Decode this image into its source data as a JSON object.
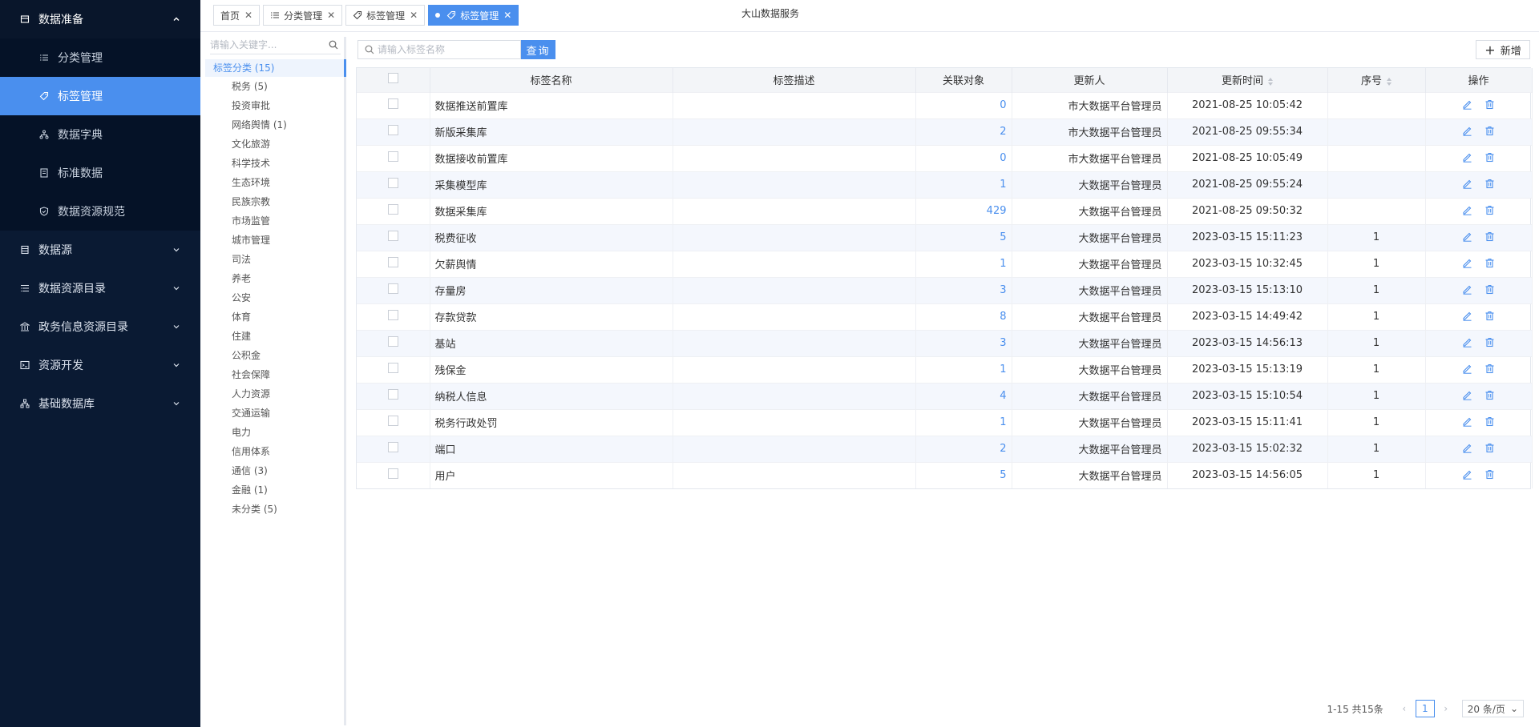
{
  "app_title": "大山数据服务",
  "sidebar": {
    "groups": [
      {
        "label": "数据准备",
        "open": true,
        "icon": "box-icon",
        "items": [
          {
            "label": "分类管理",
            "icon": "list-icon"
          },
          {
            "label": "标签管理",
            "icon": "tag-icon",
            "active": true
          },
          {
            "label": "数据字典",
            "icon": "tree-icon"
          },
          {
            "label": "标准数据",
            "icon": "doc-icon"
          },
          {
            "label": "数据资源规范",
            "icon": "shield-icon"
          }
        ]
      },
      {
        "label": "数据源",
        "icon": "database-icon"
      },
      {
        "label": "数据资源目录",
        "icon": "catalog-icon"
      },
      {
        "label": "政务信息资源目录",
        "icon": "building-icon"
      },
      {
        "label": "资源开发",
        "icon": "terminal-icon"
      },
      {
        "label": "基础数据库",
        "icon": "network-icon"
      }
    ]
  },
  "tabs": [
    {
      "label": "首页",
      "icon": null
    },
    {
      "label": "分类管理",
      "icon": "list-icon"
    },
    {
      "label": "标签管理",
      "icon": "tag-icon"
    },
    {
      "label": "标签管理",
      "icon": "tag-icon",
      "active": true
    }
  ],
  "tree": {
    "search_placeholder": "请输入关键字...",
    "root": "标签分类 (15)",
    "nodes": [
      "税务 (5)",
      "投资审批",
      "网络舆情 (1)",
      "文化旅游",
      "科学技术",
      "生态环境",
      "民族宗教",
      "市场监管",
      "城市管理",
      "司法",
      "养老",
      "公安",
      "体育",
      "住建",
      "公积金",
      "社会保障",
      "人力资源",
      "交通运输",
      "电力",
      "信用体系",
      "通信 (3)",
      "金融 (1)",
      "未分类 (5)"
    ]
  },
  "toolbar": {
    "search_placeholder": "请输入标签名称",
    "query_label": "查询",
    "add_label": "新增"
  },
  "table": {
    "columns": [
      "标签名称",
      "标签描述",
      "关联对象",
      "更新人",
      "更新时间",
      "序号",
      "操作"
    ],
    "rows": [
      {
        "name": "数据推送前置库",
        "desc": "",
        "count": "0",
        "updater": "市大数据平台管理员",
        "time": "2021-08-25 10:05:42",
        "seq": ""
      },
      {
        "name": "新版采集库",
        "desc": "",
        "count": "2",
        "updater": "市大数据平台管理员",
        "time": "2021-08-25 09:55:34",
        "seq": ""
      },
      {
        "name": "数据接收前置库",
        "desc": "",
        "count": "0",
        "updater": "市大数据平台管理员",
        "time": "2021-08-25 10:05:49",
        "seq": ""
      },
      {
        "name": "采集模型库",
        "desc": "",
        "count": "1",
        "updater": "大数据平台管理员",
        "time": "2021-08-25 09:55:24",
        "seq": ""
      },
      {
        "name": "数据采集库",
        "desc": "",
        "count": "429",
        "updater": "大数据平台管理员",
        "time": "2021-08-25 09:50:32",
        "seq": ""
      },
      {
        "name": "税费征收",
        "desc": "",
        "count": "5",
        "updater": "大数据平台管理员",
        "time": "2023-03-15 15:11:23",
        "seq": "1"
      },
      {
        "name": "欠薪舆情",
        "desc": "",
        "count": "1",
        "updater": "大数据平台管理员",
        "time": "2023-03-15 10:32:45",
        "seq": "1"
      },
      {
        "name": "存量房",
        "desc": "",
        "count": "3",
        "updater": "大数据平台管理员",
        "time": "2023-03-15 15:13:10",
        "seq": "1"
      },
      {
        "name": "存款贷款",
        "desc": "",
        "count": "8",
        "updater": "大数据平台管理员",
        "time": "2023-03-15 14:49:42",
        "seq": "1"
      },
      {
        "name": "基站",
        "desc": "",
        "count": "3",
        "updater": "大数据平台管理员",
        "time": "2023-03-15 14:56:13",
        "seq": "1"
      },
      {
        "name": "残保金",
        "desc": "",
        "count": "1",
        "updater": "大数据平台管理员",
        "time": "2023-03-15 15:13:19",
        "seq": "1"
      },
      {
        "name": "纳税人信息",
        "desc": "",
        "count": "4",
        "updater": "大数据平台管理员",
        "time": "2023-03-15 15:10:54",
        "seq": "1"
      },
      {
        "name": "税务行政处罚",
        "desc": "",
        "count": "1",
        "updater": "大数据平台管理员",
        "time": "2023-03-15 15:11:41",
        "seq": "1"
      },
      {
        "name": "端口",
        "desc": "",
        "count": "2",
        "updater": "大数据平台管理员",
        "time": "2023-03-15 15:02:32",
        "seq": "1"
      },
      {
        "name": "用户",
        "desc": "",
        "count": "5",
        "updater": "大数据平台管理员",
        "time": "2023-03-15 14:56:05",
        "seq": "1"
      }
    ]
  },
  "pagination": {
    "total_text": "1-15 共15条",
    "current_page": "1",
    "page_size": "20 条/页"
  },
  "colors": {
    "accent": "#4a8fee",
    "sidebar_bg": "#0a1a33"
  }
}
